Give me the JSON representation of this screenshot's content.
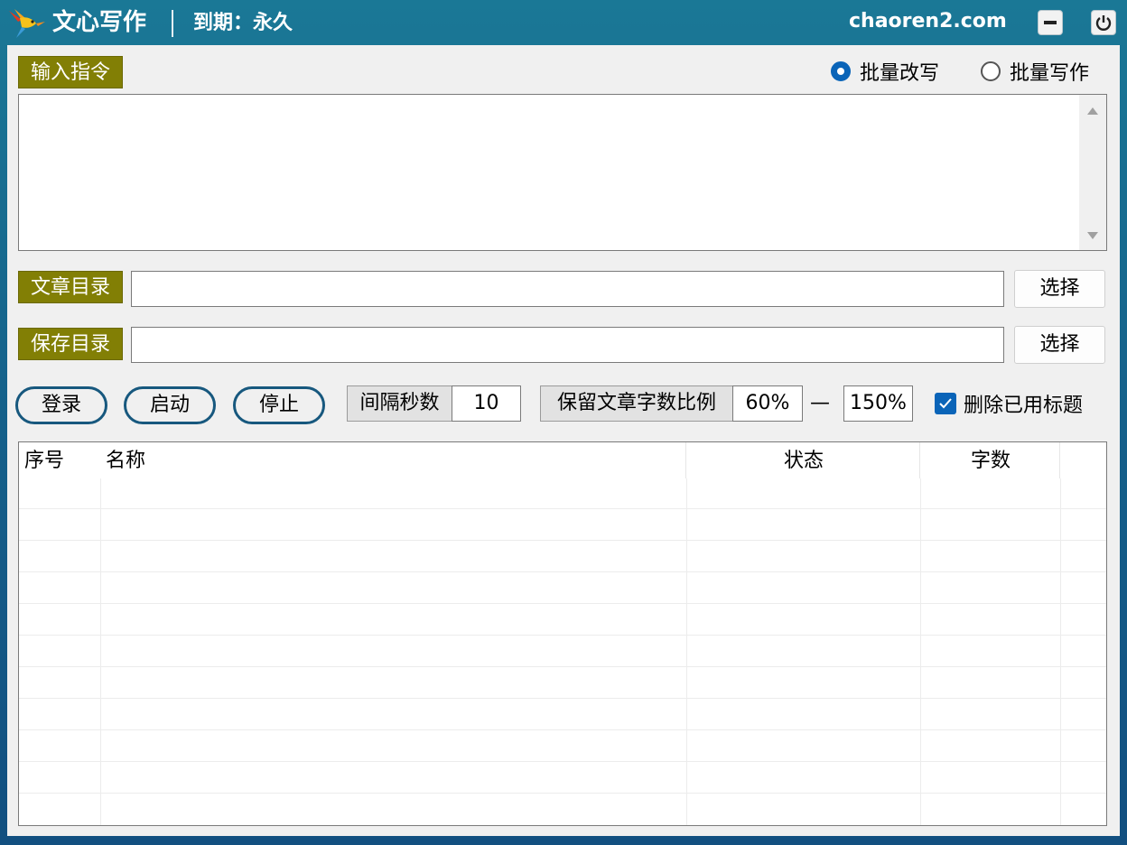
{
  "titlebar": {
    "app_name": "文心写作",
    "expiry": "到期：永久",
    "site": "chaoren2.com"
  },
  "command": {
    "label": "输入指令",
    "text": ""
  },
  "mode": {
    "options": [
      "批量改写",
      "批量写作"
    ],
    "selected": "批量改写"
  },
  "article_dir": {
    "label": "文章目录",
    "value": "",
    "button": "选择"
  },
  "save_dir": {
    "label": "保存目录",
    "value": "",
    "button": "选择"
  },
  "controls": {
    "login": "登录",
    "start": "启动",
    "stop": "停止",
    "interval_label": "间隔秒数",
    "interval_value": "10",
    "ratio_label": "保留文章字数比例",
    "ratio_min": "60%",
    "ratio_sep": "—",
    "ratio_max": "150%",
    "delete_used_label": "删除已用标题",
    "delete_used_checked": true
  },
  "table": {
    "columns": [
      "序号",
      "名称",
      "状态",
      "字数"
    ],
    "rows": []
  },
  "colors": {
    "accent": "#0a64b8",
    "label_bg": "#827f05",
    "titlebar": "#1a7896"
  }
}
